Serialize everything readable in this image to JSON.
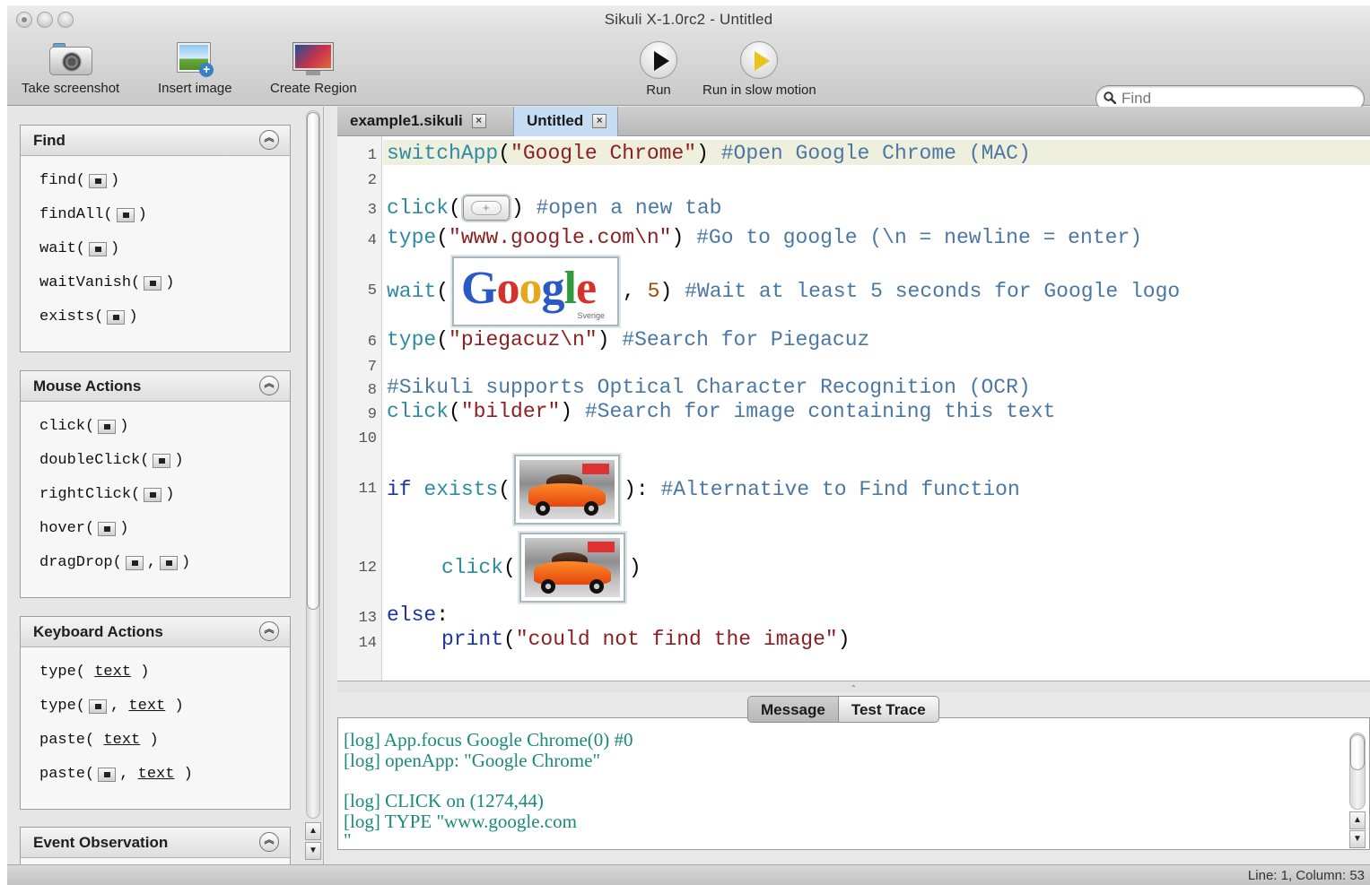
{
  "window": {
    "title": "Sikuli X-1.0rc2 - Untitled"
  },
  "toolbar": {
    "take_screenshot": "Take screenshot",
    "insert_image": "Insert image",
    "create_region": "Create Region",
    "run": "Run",
    "run_slow": "Run in slow motion",
    "find_placeholder": "Find"
  },
  "sidebar": {
    "find": {
      "title": "Find",
      "items": [
        "find(",
        "findAll(",
        "wait(",
        "waitVanish(",
        "exists("
      ]
    },
    "mouse": {
      "title": "Mouse Actions",
      "items": [
        "click(",
        "doubleClick(",
        "rightClick(",
        "hover(",
        "dragDrop("
      ]
    },
    "keyboard": {
      "title": "Keyboard Actions",
      "items": [
        "type(",
        "type(",
        "paste(",
        "paste("
      ],
      "text_param": "text"
    },
    "events": {
      "title": "Event Observation"
    },
    "close_paren": ")",
    "comma": ","
  },
  "tabs": [
    {
      "label": "example1.sikuli",
      "active": false
    },
    {
      "label": "Untitled",
      "active": true
    }
  ],
  "editor": {
    "line_numbers": [
      "1",
      "2",
      "3",
      "4",
      "5",
      "6",
      "7",
      "8",
      "9",
      "10",
      "11",
      "12",
      "13",
      "14"
    ],
    "l1": {
      "fn": "switchApp",
      "open": "(",
      "str": "\"Google Chrome\"",
      "close": ")",
      "cm": "#Open Google Chrome (MAC)"
    },
    "l3": {
      "fn": "click",
      "open": "(",
      "close": ")",
      "cm": "#open a new tab"
    },
    "l4": {
      "fn": "type",
      "open": "(",
      "str": "\"www.google.com\\n\"",
      "close": ")",
      "cm": "#Go to google (\\n = newline = enter)"
    },
    "l5": {
      "fn": "wait",
      "open": "(",
      "comma": ",",
      "num": "5",
      "close": ")",
      "cm": "#Wait at least 5 seconds for Google logo"
    },
    "l6": {
      "fn": "type",
      "open": "(",
      "str": "\"piegacuz\\n\"",
      "close": ")",
      "cm": "#Search for Piegacuz"
    },
    "l8": {
      "cm": "#Sikuli supports Optical Character Recognition (OCR)"
    },
    "l9": {
      "fn": "click",
      "open": "(",
      "str": "\"bilder\"",
      "close": ")",
      "cm": "#Search for image containing this text"
    },
    "l11": {
      "kw": "if",
      "fn": "exists",
      "open": "(",
      "close": "):",
      "cm": "#Alternative to Find function"
    },
    "l12": {
      "fn": "click",
      "open": "(",
      "close": ")"
    },
    "l13": {
      "kw": "else",
      "colon": ":"
    },
    "l14": {
      "fn": "print",
      "open": "(",
      "str": "\"could not find the image\"",
      "close": ")"
    },
    "google_logo": "Google",
    "google_sub": "Sverige"
  },
  "messages": {
    "tab_message": "Message",
    "tab_trace": "Test Trace",
    "logs": [
      "[log] App.focus Google Chrome(0) #0",
      "[log] openApp: \"Google Chrome\"",
      "",
      "[log] CLICK on (1274,44)",
      "[log] TYPE \"www.google.com",
      "\""
    ]
  },
  "status": {
    "position": "Line: 1, Column: 53"
  },
  "colors": {
    "function": "#2d8ba3",
    "keyword": "#1b34a8",
    "string": "#8a2020",
    "comment": "#4a77a4",
    "log": "#1a8a7a",
    "active_tab": "#c6dcf2"
  }
}
